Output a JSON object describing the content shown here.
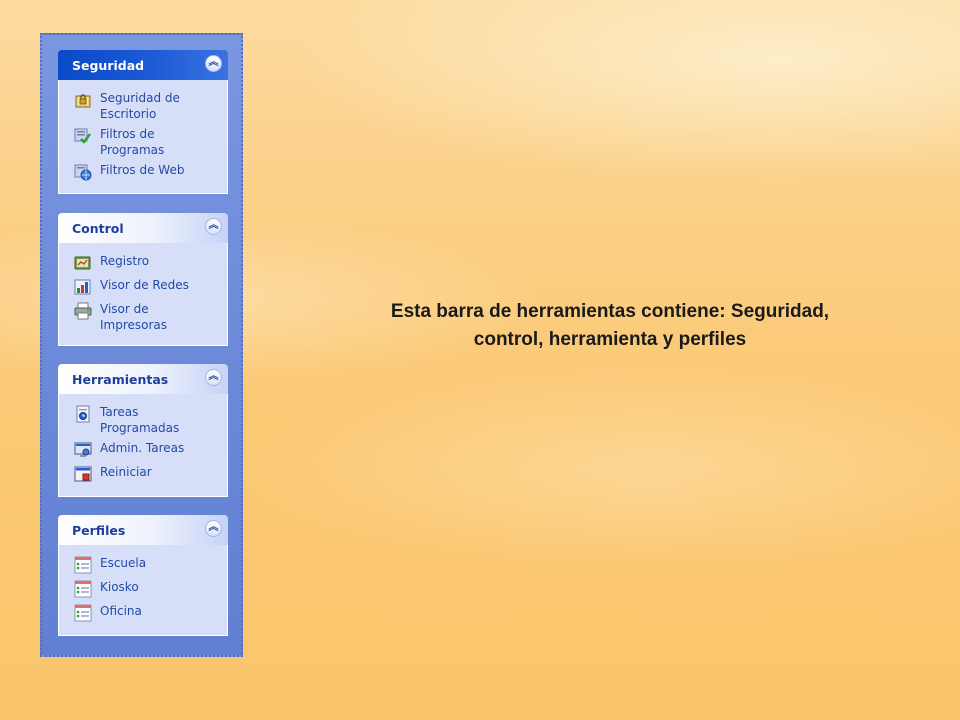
{
  "sidebar": {
    "groups": [
      {
        "title": "Seguridad",
        "collapse_icon": "chevron-double-up-icon",
        "items": [
          {
            "label": "Seguridad de\nEscritorio",
            "icon": "padlock-icon"
          },
          {
            "label": "Filtros de\nProgramas",
            "icon": "checkmark-icon"
          },
          {
            "label": "Filtros de Web",
            "icon": "globe-icon"
          }
        ]
      },
      {
        "title": "Control",
        "collapse_icon": "chevron-double-up-icon",
        "items": [
          {
            "label": "Registro",
            "icon": "log-icon"
          },
          {
            "label": "Visor de Redes",
            "icon": "network-chart-icon"
          },
          {
            "label": "Visor de\nImpresoras",
            "icon": "printer-icon"
          }
        ]
      },
      {
        "title": "Herramientas",
        "collapse_icon": "chevron-double-up-icon",
        "items": [
          {
            "label": "Tareas\nProgramadas",
            "icon": "scheduled-task-icon"
          },
          {
            "label": "Admin. Tareas",
            "icon": "task-manager-icon"
          },
          {
            "label": "Reiniciar",
            "icon": "restart-icon"
          }
        ]
      },
      {
        "title": "Perfiles",
        "collapse_icon": "chevron-double-up-icon",
        "items": [
          {
            "label": "Escuela",
            "icon": "profile-list-icon"
          },
          {
            "label": "Kiosko",
            "icon": "profile-list-icon"
          },
          {
            "label": "Oficina",
            "icon": "profile-list-icon"
          }
        ]
      }
    ]
  },
  "caption": "Esta barra de herramientas contiene: Seguridad,\ncontrol, herramienta y perfiles",
  "colors": {
    "header_active": "#0a4ac7",
    "header_inactive": "#ffffff",
    "panel_bg": "#6d8ad9",
    "body_bg": "#d6dff7",
    "label_text": "#244aa8"
  }
}
